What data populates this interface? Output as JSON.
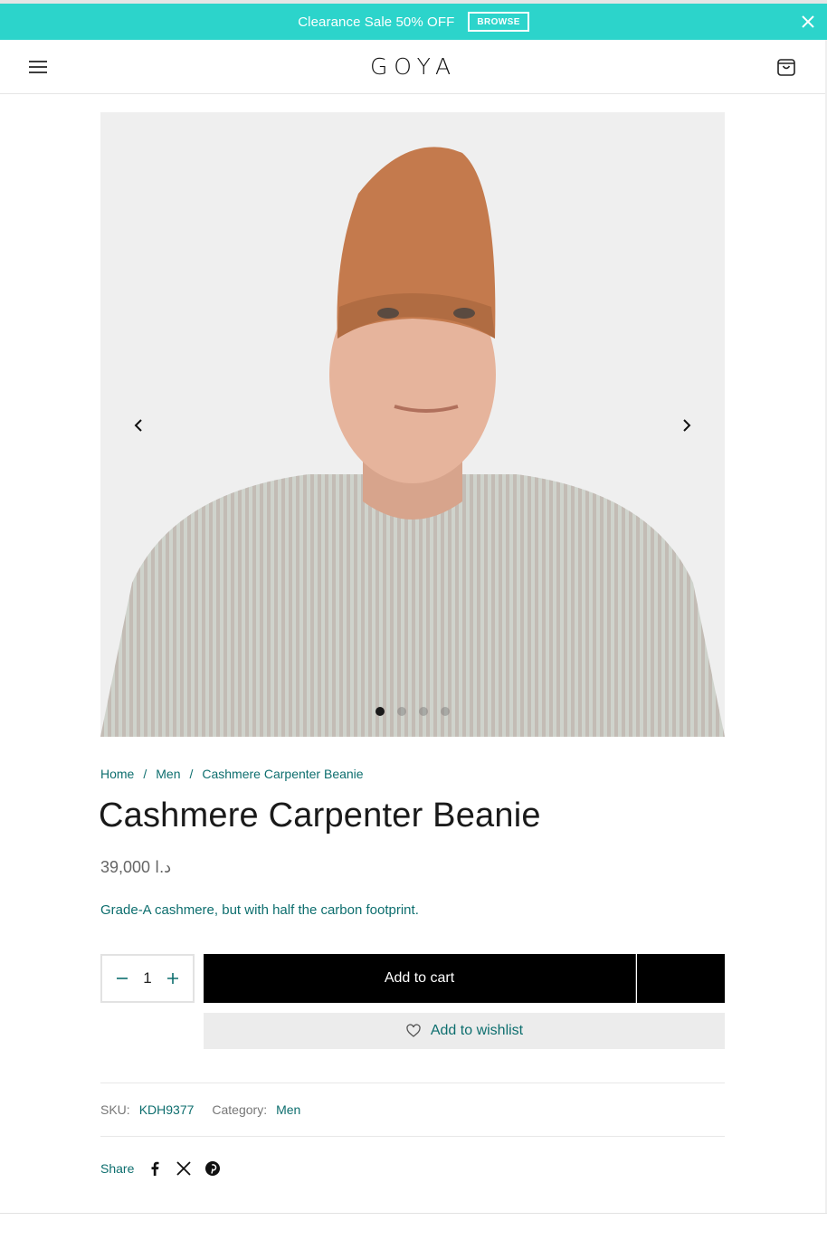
{
  "promo": {
    "text": "Clearance Sale 50% OFF",
    "button": "BROWSE",
    "background": "#2cd4cb"
  },
  "header": {
    "logo": "GOYA",
    "menu_icon": "hamburger-icon",
    "cart_icon": "shopping-bag-icon"
  },
  "gallery": {
    "slide_count": 4,
    "active_slide": 1
  },
  "breadcrumb": {
    "home": "Home",
    "category": "Men",
    "current": "Cashmere Carpenter Beanie",
    "separator": "/"
  },
  "product": {
    "title": "Cashmere Carpenter Beanie",
    "price": "د.ا 39,000",
    "description": "Grade-A cashmere, but with half the carbon footprint.",
    "quantity": "1",
    "add_to_cart": "Add to cart",
    "add_to_wishlist": "Add to wishlist"
  },
  "meta": {
    "sku_label": "SKU:",
    "sku": "KDH9377",
    "category_label": "Category:",
    "category": "Men"
  },
  "share": {
    "label": "Share",
    "icons": [
      "facebook-icon",
      "x-icon",
      "pinterest-icon"
    ]
  },
  "colors": {
    "accent": "#0d6e6e",
    "promo": "#2cd4cb",
    "button": "#000000"
  }
}
